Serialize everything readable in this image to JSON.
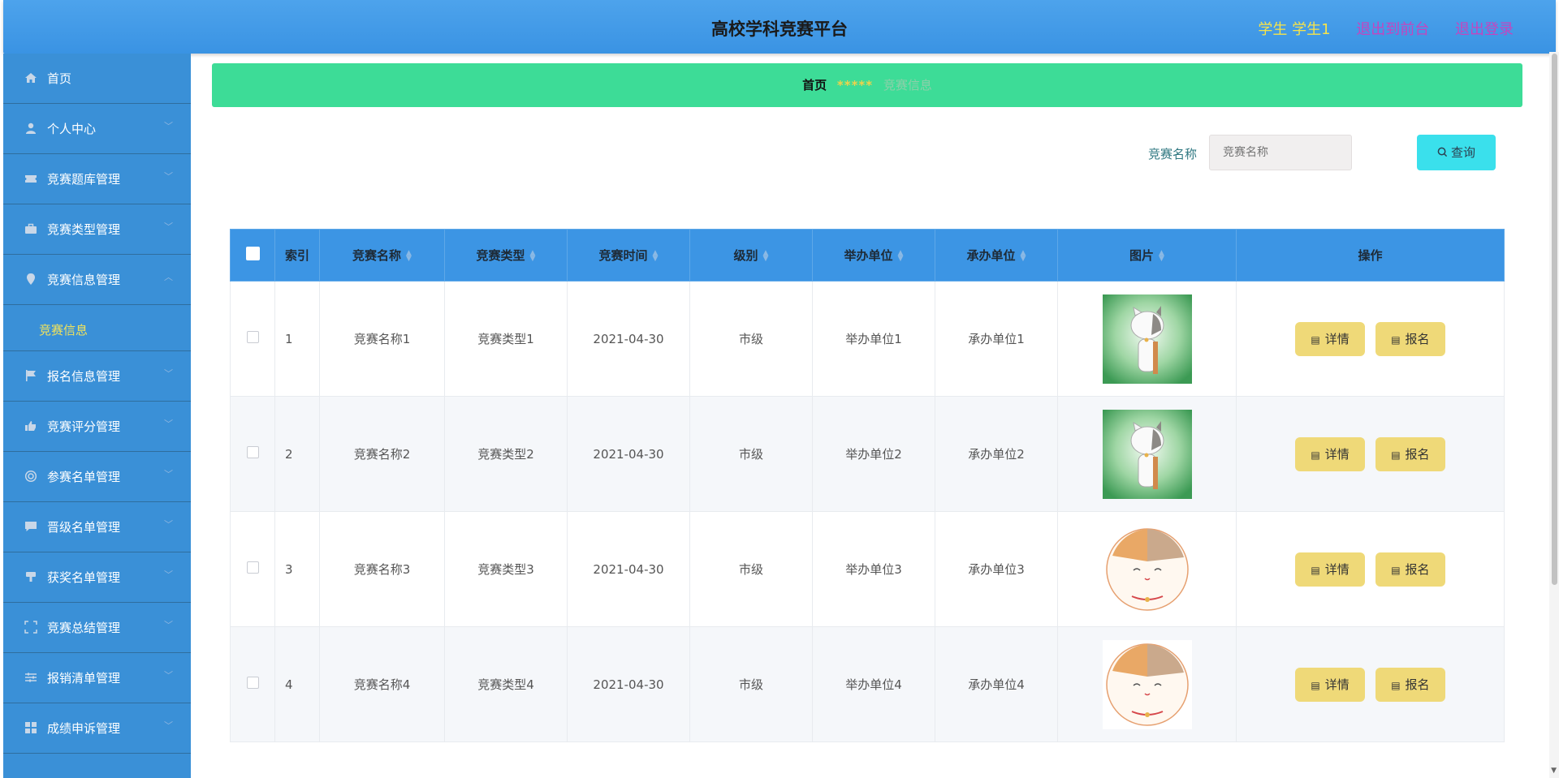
{
  "header": {
    "title": "高校学科竞赛平台",
    "user": "学生 学生1",
    "front_link": "退出到前台",
    "logout": "退出登录"
  },
  "sidebar": {
    "items": [
      {
        "label": "首页",
        "icon": "home-icon"
      },
      {
        "label": "个人中心",
        "icon": "user-icon"
      },
      {
        "label": "竞赛题库管理",
        "icon": "ticket-icon"
      },
      {
        "label": "竞赛类型管理",
        "icon": "briefcase-icon"
      },
      {
        "label": "竞赛信息管理",
        "icon": "location-icon",
        "expanded": true
      },
      {
        "label": "报名信息管理",
        "icon": "flag-icon"
      },
      {
        "label": "竞赛评分管理",
        "icon": "thumb-icon"
      },
      {
        "label": "参赛名单管理",
        "icon": "lifebuoy-icon"
      },
      {
        "label": "晋级名单管理",
        "icon": "message-icon"
      },
      {
        "label": "获奖名单管理",
        "icon": "award-icon"
      },
      {
        "label": "竞赛总结管理",
        "icon": "fullscreen-icon"
      },
      {
        "label": "报销清单管理",
        "icon": "sliders-icon"
      },
      {
        "label": "成绩申诉管理",
        "icon": "grid-icon"
      }
    ],
    "sub_item": "竞赛信息"
  },
  "breadcrumb": {
    "home": "首页",
    "separator": "*****",
    "current": "竞赛信息"
  },
  "search": {
    "label": "竞赛名称",
    "placeholder": "竞赛名称",
    "button": "查询"
  },
  "table": {
    "columns": [
      "索引",
      "竞赛名称",
      "竞赛类型",
      "竞赛时间",
      "级别",
      "举办单位",
      "承办单位",
      "图片",
      "操作"
    ],
    "rows": [
      {
        "index": "1",
        "name": "竞赛名称1",
        "type": "竞赛类型1",
        "time": "2021-04-30",
        "level": "市级",
        "host": "举办单位1",
        "organizer": "承办单位1",
        "image": "cat-green"
      },
      {
        "index": "2",
        "name": "竞赛名称2",
        "type": "竞赛类型2",
        "time": "2021-04-30",
        "level": "市级",
        "host": "举办单位2",
        "organizer": "承办单位2",
        "image": "cat-green"
      },
      {
        "index": "3",
        "name": "竞赛名称3",
        "type": "竞赛类型3",
        "time": "2021-04-30",
        "level": "市级",
        "host": "举办单位3",
        "organizer": "承办单位3",
        "image": "cat-round"
      },
      {
        "index": "4",
        "name": "竞赛名称4",
        "type": "竞赛类型4",
        "time": "2021-04-30",
        "level": "市级",
        "host": "举办单位4",
        "organizer": "承办单位4",
        "image": "cat-round"
      }
    ],
    "action_detail": "详情",
    "action_signup": "报名"
  }
}
